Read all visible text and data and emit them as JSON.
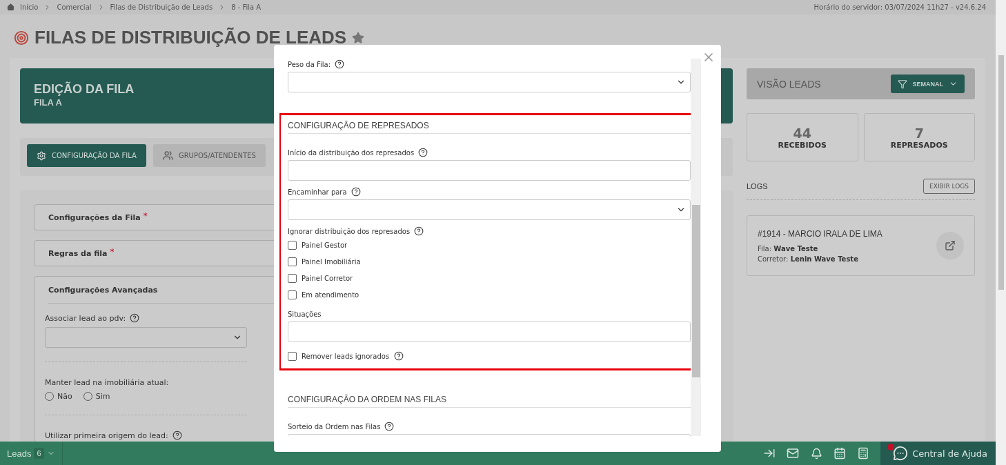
{
  "breadcrumb": [
    "Início",
    "Comercial",
    "Filas de Distribuição de Leads",
    "8 - Fila A"
  ],
  "server_info": "Horário do servidor: 03/07/2024 11h27 - v24.6.24",
  "page_title": "FILAS DE DISTRIBUIÇÃO DE LEADS",
  "queue_header": {
    "title": "EDIÇÃO DA FILA",
    "subtitle": "FILA A"
  },
  "tabs": [
    {
      "label": "CONFIGURAÇÃO DA FILA",
      "selected": true
    },
    {
      "label": "GRUPOS/ATENDENTES",
      "selected": false
    }
  ],
  "sections": [
    {
      "title": "Configurações da Fila",
      "required_mark": "*"
    },
    {
      "title": "Regras da fila",
      "required_mark": "*"
    },
    {
      "title": "Configurações Avançadas"
    }
  ],
  "advanced_fields": [
    {
      "kind": "select",
      "label": "Associar lead ao pdv:",
      "help": true
    },
    {
      "kind": "radio",
      "label": "Manter lead na imobiliária atual:",
      "help": false,
      "options": [
        {
          "label": "Não",
          "selected": false
        },
        {
          "label": "Sim",
          "selected": false
        }
      ]
    },
    {
      "kind": "label",
      "label": "Utilizar primeira origem do lead:",
      "help": true
    }
  ],
  "leads_view": {
    "title": "VISÃO LEADS",
    "filter": "SEMANAL"
  },
  "stats": [
    {
      "value": "44",
      "label": "RECEBIDOS"
    },
    {
      "value": "7",
      "label": "REPRESADOS"
    }
  ],
  "logs": {
    "title": "LOGS",
    "button": "EXIBIR LOGS",
    "entries": [
      {
        "title": "#1914 - MARCIO IRALA DE LIMA",
        "fields": [
          {
            "label": "Fila:",
            "value": "Wave Teste"
          },
          {
            "label": "Corretor:",
            "value": "Lenin Wave Teste"
          }
        ]
      }
    ]
  },
  "modal": {
    "top_fields": [
      {
        "kind": "select",
        "label": "Peso da Fila:",
        "help": true
      }
    ],
    "highlighted_section": {
      "title": "CONFIGURAÇÃO DE REPRESADOS",
      "items": [
        {
          "kind": "text",
          "label": "Início da distribuição dos represados",
          "help": true
        },
        {
          "kind": "select",
          "label": "Encaminhar para",
          "help": true
        },
        {
          "kind": "group",
          "label": "Ignorar distribuição dos represados",
          "help": true,
          "options": [
            {
              "label": "Painel Gestor",
              "checked": false
            },
            {
              "label": "Painel Imobiliária",
              "checked": false
            },
            {
              "label": "Painel Corretor",
              "checked": false
            },
            {
              "label": "Em atendimento",
              "checked": false
            }
          ]
        },
        {
          "kind": "text",
          "label": "Situações",
          "help": false
        },
        {
          "kind": "checkbox",
          "label": "Remover leads ignorados",
          "help": true,
          "checked": false
        }
      ]
    },
    "next_section": {
      "title": "CONFIGURAÇÃO DA ORDEM NAS FILAS",
      "items": [
        {
          "kind": "text",
          "label": "Sorteio da Ordem nas Filas",
          "help": true
        }
      ]
    }
  },
  "bottom_bar": {
    "leads_label": "Leads",
    "leads_count": "6",
    "help_center": "Central de Ajuda",
    "notification": true
  }
}
